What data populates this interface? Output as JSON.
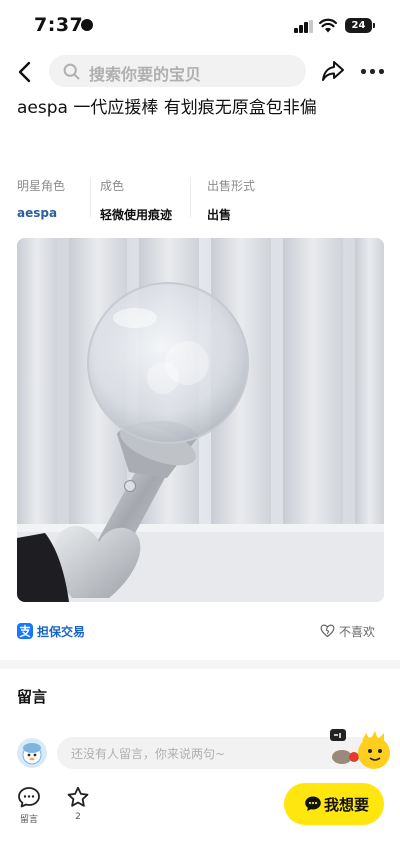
{
  "status_bar": {
    "time": "7:37",
    "battery": "24"
  },
  "nav": {
    "search_placeholder": "搜索你要的宝贝"
  },
  "item": {
    "title": "aespa 一代应援棒 有划痕无原盒包非偏",
    "attributes": [
      {
        "label": "明星角色",
        "value": "aespa"
      },
      {
        "label": "成色",
        "value": "轻微使用痕迹"
      },
      {
        "label": "出售形式",
        "value": "出售"
      }
    ]
  },
  "actions": {
    "guarantee": "担保交易",
    "dislike": "不喜欢"
  },
  "comments": {
    "title": "留言",
    "placeholder": "还没有人留言，你来说两句~"
  },
  "bottom_bar": {
    "comment_label": "留言",
    "favorite_count": "2",
    "want_label": "我想要"
  },
  "colors": {
    "brand_yellow": "#ffe60f",
    "link_blue": "#2d5e9f",
    "guarantee_blue": "#1766c2"
  },
  "icons": [
    "back-arrow-icon",
    "search-icon",
    "share-icon",
    "more-icon",
    "guarantee-icon",
    "broken-heart-icon",
    "comment-icon",
    "star-icon",
    "chat-icon"
  ]
}
